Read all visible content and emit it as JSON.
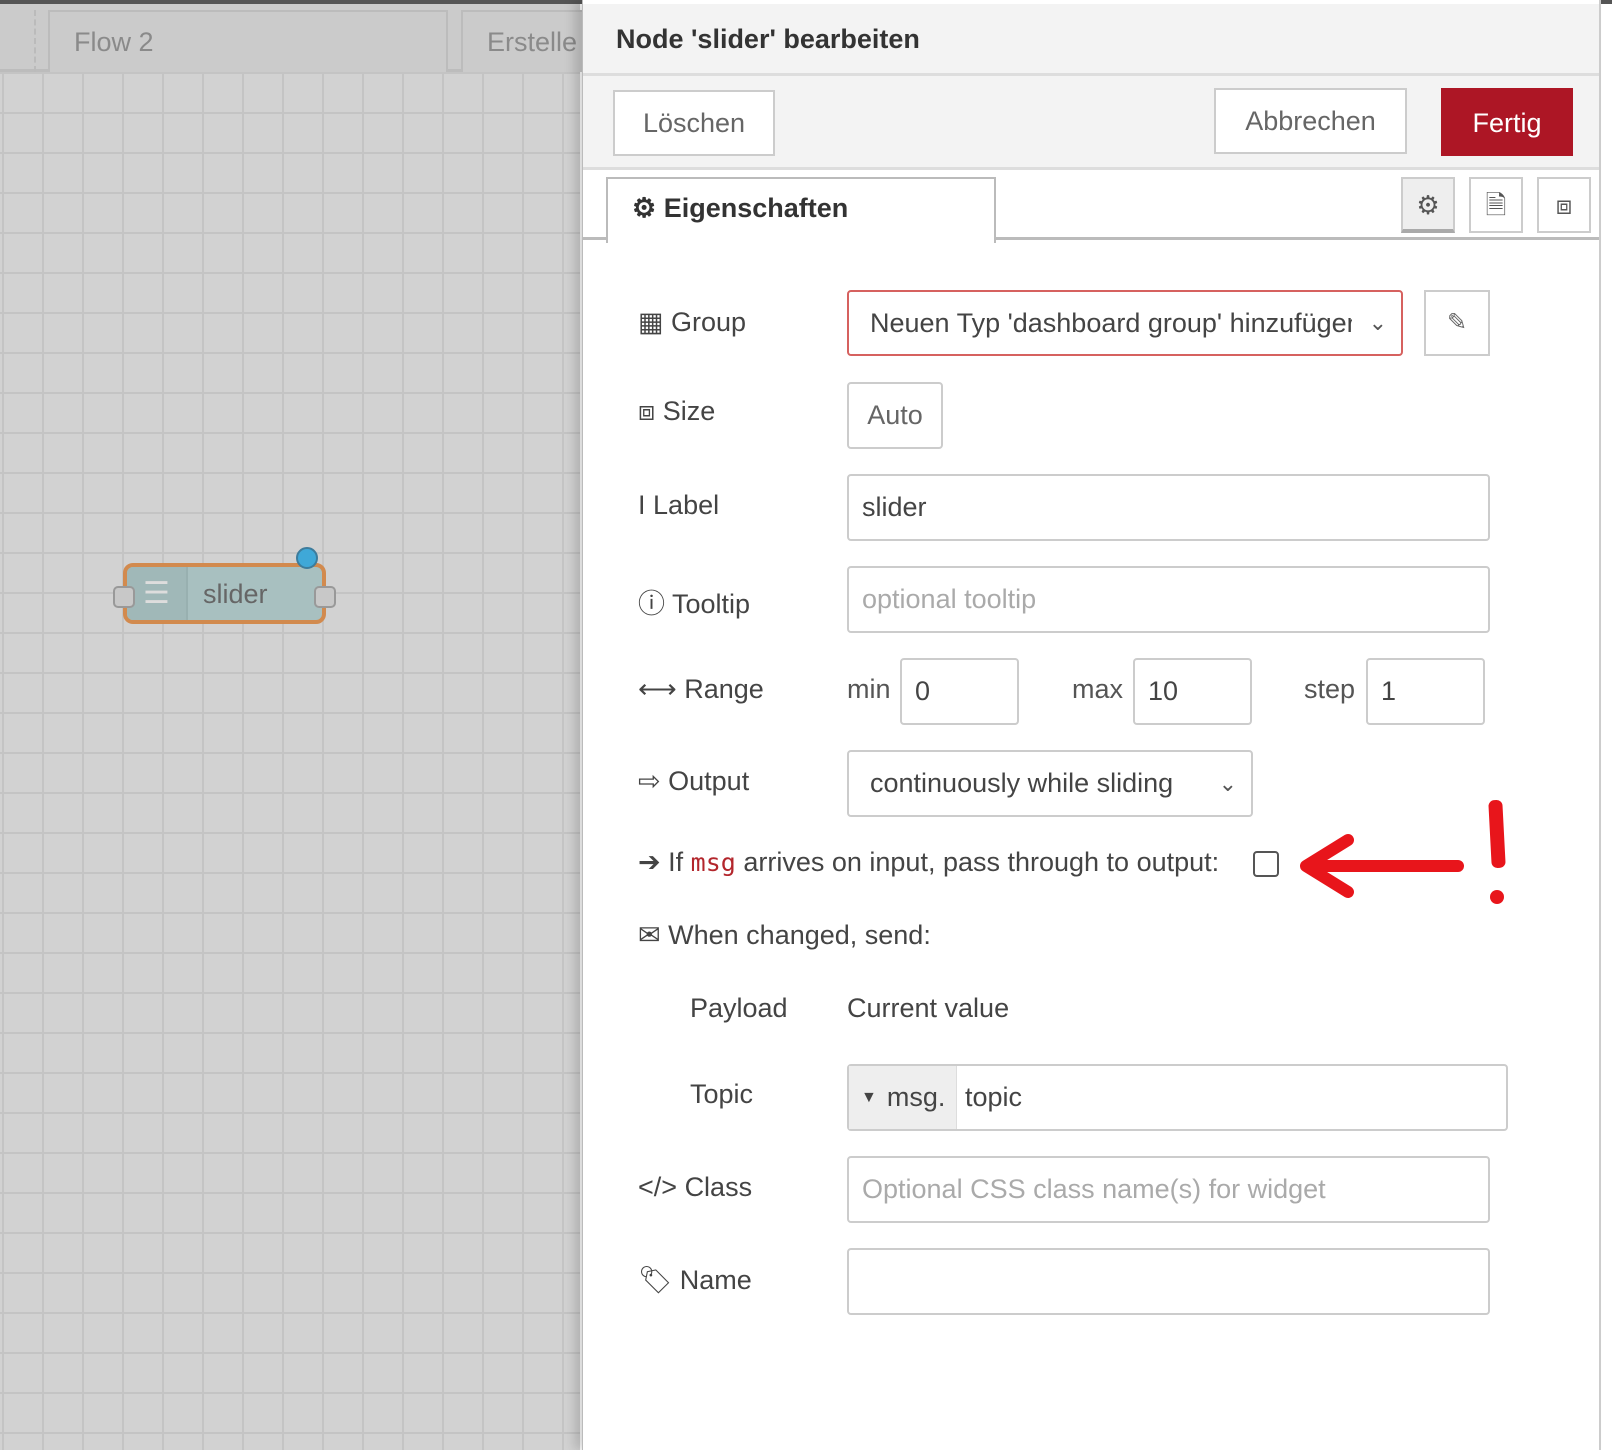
{
  "workspace": {
    "tabs": [
      "Flow 2",
      "Erstelle"
    ],
    "node": {
      "label": "slider"
    }
  },
  "dialog": {
    "title": "Node 'slider' bearbeiten",
    "delete_label": "Löschen",
    "cancel_label": "Abbrechen",
    "done_label": "Fertig",
    "done_color": "#ad1625",
    "tab_label": "Eigenschaften",
    "fields": {
      "group": {
        "label": "Group",
        "value": "Neuen Typ 'dashboard group' hinzufügen..."
      },
      "size": {
        "label": "Size",
        "value": "Auto"
      },
      "label": {
        "label": "Label",
        "value": "slider"
      },
      "tooltip": {
        "label": "Tooltip",
        "placeholder": "optional tooltip"
      },
      "range": {
        "label": "Range",
        "min_label": "min",
        "min": "0",
        "max_label": "max",
        "max": "10",
        "step_label": "step",
        "step": "1"
      },
      "output": {
        "label": "Output",
        "value": "continuously while sliding"
      },
      "passthrough": {
        "prefix": "If",
        "code": "msg",
        "suffix": "arrives on input, pass through to output:",
        "checked": false
      },
      "when_changed": {
        "label": "When changed, send:"
      },
      "payload": {
        "label": "Payload",
        "value": "Current value"
      },
      "topic": {
        "label": "Topic",
        "type": "msg.",
        "value": "topic"
      },
      "class": {
        "label": "Class",
        "placeholder": "Optional CSS class name(s) for widget"
      },
      "name": {
        "label": "Name",
        "value": ""
      }
    }
  },
  "annotation": {
    "color": "#e8151b",
    "mark": "!"
  }
}
